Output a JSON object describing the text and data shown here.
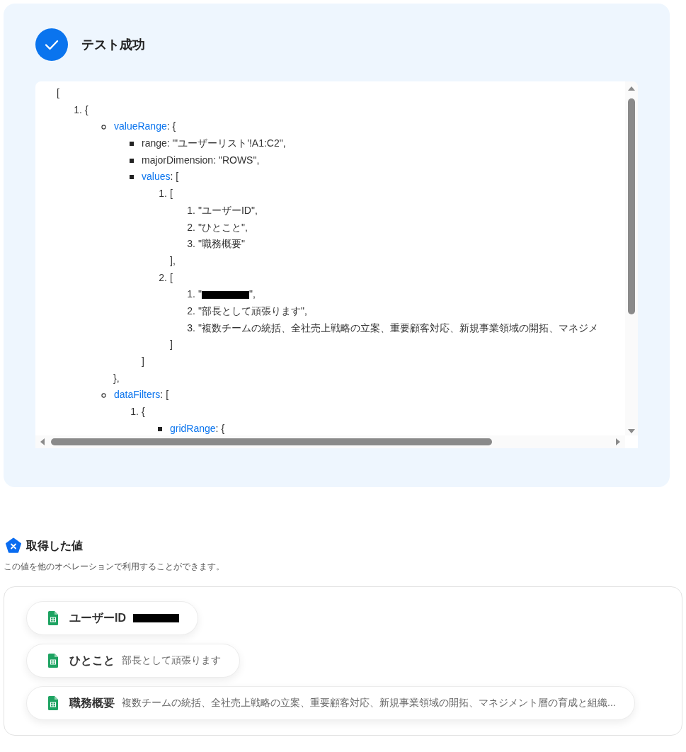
{
  "result": {
    "title": "テスト成功",
    "tree": {
      "open": "[",
      "items": [
        {
          "kind": "number",
          "number": "1.",
          "text": "{",
          "children": [
            {
              "kind": "circle",
              "key": "valueRange",
              "text": ": {",
              "close": "},",
              "children": [
                {
                  "kind": "square",
                  "text": "range: \"'ユーザーリスト'!A1:C2\","
                },
                {
                  "kind": "square",
                  "text": "majorDimension: \"ROWS\","
                },
                {
                  "kind": "square",
                  "key": "values",
                  "text": ": [",
                  "close": "]",
                  "children": [
                    {
                      "kind": "number",
                      "number": "1.",
                      "text": "[",
                      "close": "],",
                      "children": [
                        {
                          "kind": "number",
                          "number": "1.",
                          "text": "\"ユーザーID\","
                        },
                        {
                          "kind": "number",
                          "number": "2.",
                          "text": "\"ひとこと\","
                        },
                        {
                          "kind": "number",
                          "number": "3.",
                          "text": "\"職務概要\""
                        }
                      ]
                    },
                    {
                      "kind": "number",
                      "number": "2.",
                      "text": "[",
                      "close": "]",
                      "children": [
                        {
                          "kind": "number",
                          "number": "1.",
                          "text": "\"",
                          "redacted": true,
                          "after": "\","
                        },
                        {
                          "kind": "number",
                          "number": "2.",
                          "text": "\"部長として頑張ります\","
                        },
                        {
                          "kind": "number",
                          "number": "3.",
                          "text": "\"複数チームの統括、全社売上戦略の立案、重要顧客対応、新規事業領域の開拓、マネジメ"
                        }
                      ]
                    }
                  ]
                }
              ]
            },
            {
              "kind": "circle",
              "key": "dataFilters",
              "text": ": [",
              "children": [
                {
                  "kind": "number",
                  "number": "1.",
                  "text": "{",
                  "children": [
                    {
                      "kind": "square",
                      "key": "gridRange",
                      "text": ": {"
                    }
                  ]
                }
              ]
            }
          ]
        }
      ]
    }
  },
  "values_section": {
    "title": "取得した値",
    "description": "この値を他のオペレーションで利用することができます。",
    "chips": [
      {
        "label": "ユーザーID",
        "redacted": true
      },
      {
        "label": "ひとこと",
        "value": "部長として頑張ります"
      },
      {
        "label": "職務概要",
        "value": "複数チームの統括、全社売上戦略の立案、重要顧客対応、新規事業領域の開拓、マネジメント層の育成と組織..."
      }
    ]
  }
}
